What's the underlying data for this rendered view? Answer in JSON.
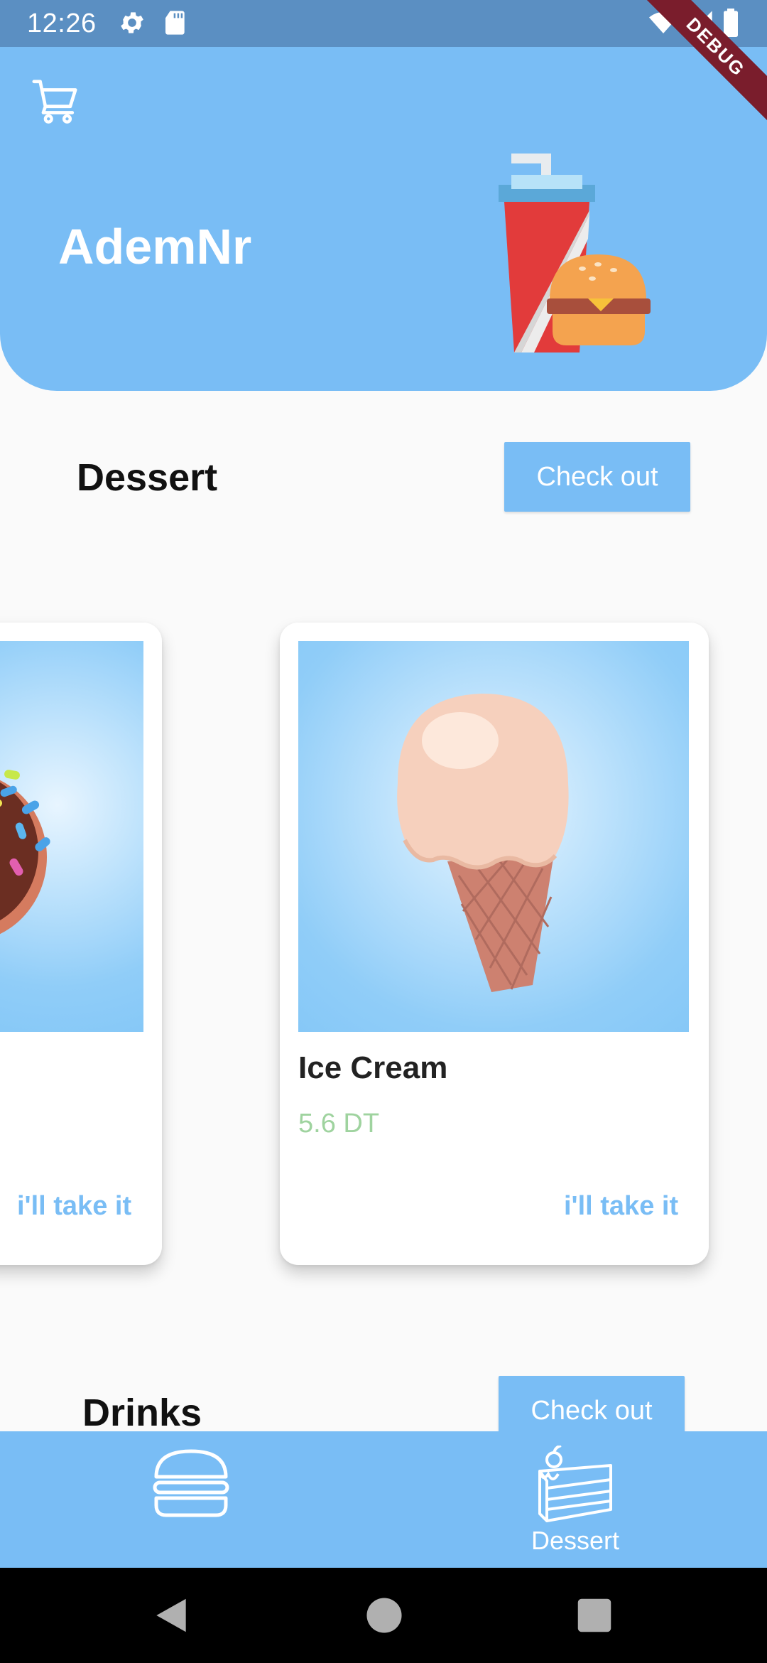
{
  "status_bar": {
    "time": "12:26",
    "debug_label": "DEBUG",
    "icons": [
      "settings-icon",
      "sd-card-icon",
      "wifi-icon",
      "signal-icon",
      "battery-icon"
    ]
  },
  "header": {
    "title": "AdemNr",
    "background_color": "#79bdf5",
    "cart_icon": "cart-icon",
    "illustration": "drink-and-burger-illustration"
  },
  "sections": {
    "dessert": {
      "title": "Dessert",
      "checkout_label": "Check out"
    },
    "drinks": {
      "title": "Drinks",
      "checkout_label": "Check out"
    }
  },
  "cards": [
    {
      "name": "",
      "price": "",
      "action_label": "i'll take it",
      "image": "donut-image"
    },
    {
      "name": "Ice Cream",
      "price": "5.6 DT",
      "action_label": "i'll take it",
      "image": "ice-cream-image"
    }
  ],
  "bottom_nav": {
    "items": [
      {
        "icon": "burger-icon",
        "label": ""
      },
      {
        "icon": "cake-icon",
        "label": "Dessert"
      }
    ]
  },
  "system_nav": {
    "buttons": [
      "back-icon",
      "home-icon",
      "recents-icon"
    ]
  },
  "colors": {
    "accent": "#79bdf5",
    "price": "#9fd39f",
    "status_bar": "#5b8fc2",
    "debug_ribbon": "#7a1d2c"
  }
}
